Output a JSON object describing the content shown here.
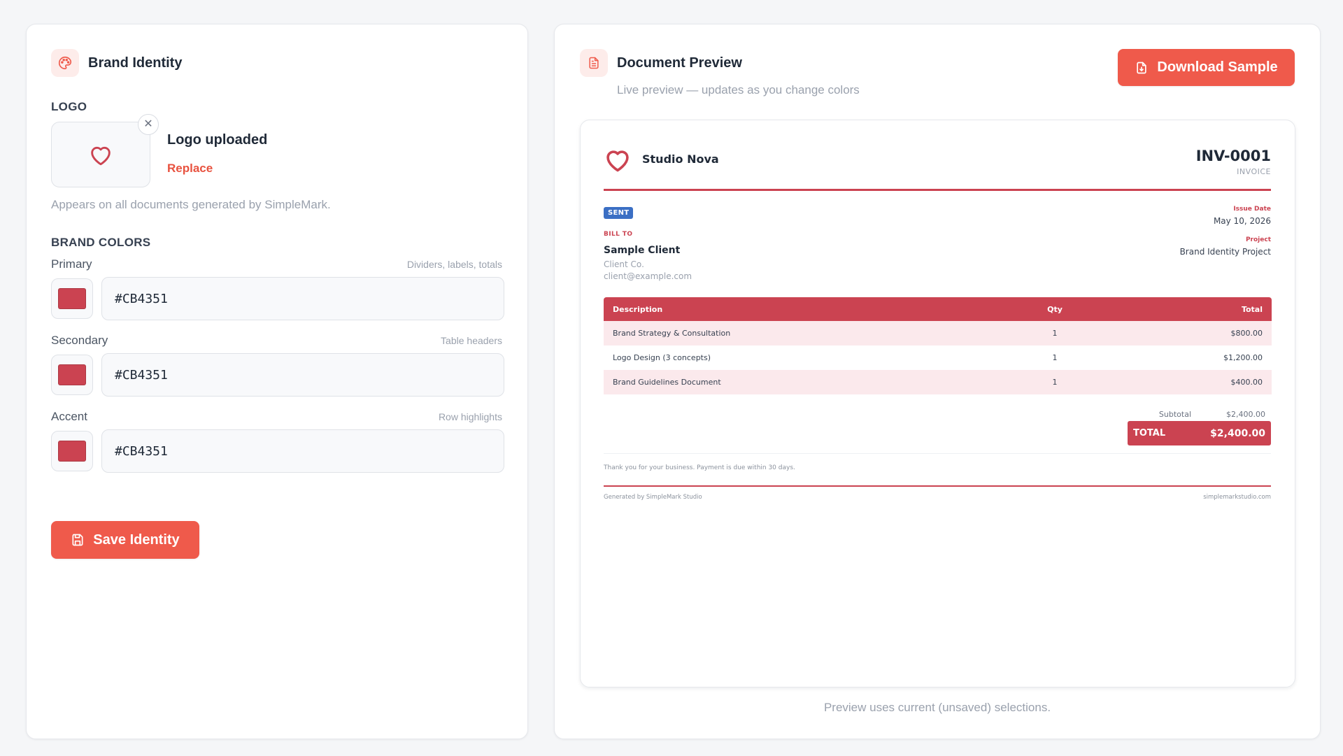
{
  "brand_panel": {
    "title": "Brand Identity",
    "logo_section_label": "LOGO",
    "logo_status": "Logo uploaded",
    "logo_replace": "Replace",
    "logo_remove_icon": "close-icon",
    "logo_help": "Appears on all documents generated by SimpleMark.",
    "colors_section_label": "BRAND COLORS",
    "colors": [
      {
        "label": "Primary",
        "hint": "Dividers, labels, totals",
        "value": "#CB4351"
      },
      {
        "label": "Secondary",
        "hint": "Table headers",
        "value": "#CB4351"
      },
      {
        "label": "Accent",
        "hint": "Row highlights",
        "value": "#CB4351"
      }
    ],
    "save_label": "Save Identity"
  },
  "preview_panel": {
    "title": "Document Preview",
    "subtitle": "Live preview — updates as you change colors",
    "download_label": "Download Sample",
    "note": "Preview uses current (unsaved) selections."
  },
  "invoice": {
    "company": "Studio Nova",
    "number": "INV-0001",
    "doc_type": "INVOICE",
    "status": "SENT",
    "bill_to_label": "BILL TO",
    "client_name": "Sample Client",
    "client_company": "Client Co.",
    "client_email": "client@example.com",
    "issue_date_label": "Issue Date",
    "issue_date": "May 10, 2026",
    "project_label": "Project",
    "project": "Brand Identity Project",
    "columns": {
      "description": "Description",
      "qty": "Qty",
      "total": "Total"
    },
    "items": [
      {
        "description": "Brand Strategy & Consultation",
        "qty": "1",
        "total": "$800.00"
      },
      {
        "description": "Logo Design (3 concepts)",
        "qty": "1",
        "total": "$1,200.00"
      },
      {
        "description": "Brand Guidelines Document",
        "qty": "1",
        "total": "$400.00"
      }
    ],
    "subtotal_label": "Subtotal",
    "subtotal": "$2,400.00",
    "total_label": "TOTAL",
    "total": "$2,400.00",
    "note": "Thank you for your business. Payment is due within 30 days.",
    "footer_left": "Generated by SimpleMark Studio",
    "footer_right": "simplemarkstudio.com"
  },
  "theme": {
    "brand_color": "#CB4351",
    "button_color": "#EF5A4B",
    "status_badge_color": "#3B6FC4",
    "row_highlight": "#FBE9EC"
  },
  "icons": {
    "brand_panel": "palette-icon",
    "preview_panel": "document-icon",
    "logo": "heart-icon",
    "save": "save-icon",
    "download": "file-download-icon"
  }
}
